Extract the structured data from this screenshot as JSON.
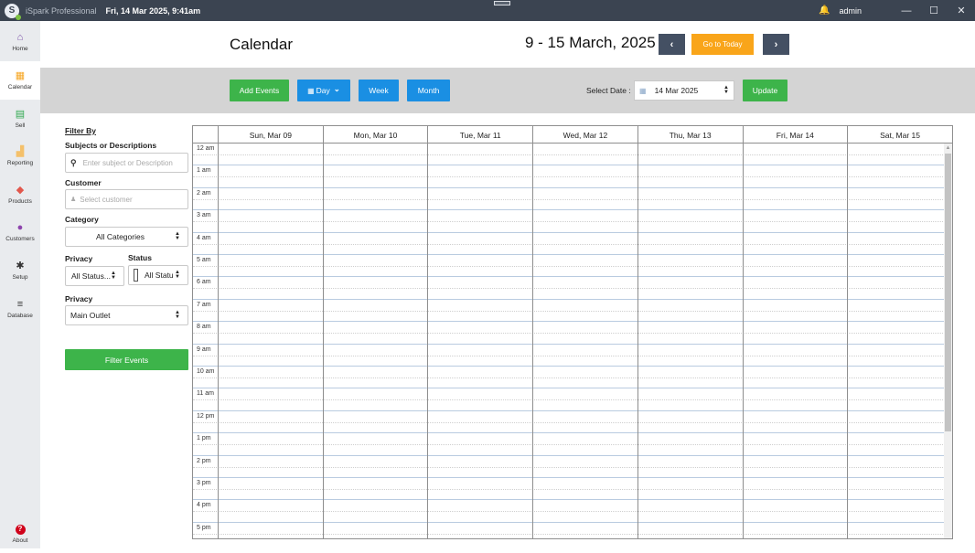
{
  "titlebar": {
    "logo": "S",
    "app_name": "iSpark Professional",
    "datetime": "Fri, 14 Mar 2025, 9:41am",
    "bell_icon": "🔔",
    "user": "admin",
    "minimize": "—",
    "maximize": "☐",
    "close": "✕"
  },
  "sidebar": {
    "items": [
      {
        "label": "Home",
        "icon": "⌂",
        "color": "#7b4fa8"
      },
      {
        "label": "Calendar",
        "icon": "▦",
        "color": "#f6a623"
      },
      {
        "label": "Sell",
        "icon": "▤",
        "color": "#2fa84f"
      },
      {
        "label": "Reporting",
        "icon": "▟",
        "color": "#f4c06a"
      },
      {
        "label": "Products",
        "icon": "◆",
        "color": "#e2574c"
      },
      {
        "label": "Customers",
        "icon": "●",
        "color": "#8e44ad"
      },
      {
        "label": "Setup",
        "icon": "✱",
        "color": "#333333"
      },
      {
        "label": "Database",
        "icon": "≡",
        "color": "#333333"
      }
    ],
    "about": {
      "label": "About",
      "icon": "?",
      "color": "#d0021b"
    }
  },
  "header": {
    "title": "Calendar",
    "range": "9 - 15 March, 2025",
    "prev_icon": "‹",
    "next_icon": "›",
    "today_label": "Go to Today"
  },
  "toolbar": {
    "add_events": "Add Events",
    "day": "Day",
    "day_icon": "▦",
    "day_chevron": "⌄",
    "week": "Week",
    "month": "Month",
    "select_date_label": "Select Date :",
    "date_value": "14 Mar 2025",
    "calendar_icon": "▦",
    "update": "Update"
  },
  "filter": {
    "heading": "Filter By",
    "subjects_label": "Subjects or Descriptions",
    "subjects_placeholder": "Enter subject or Description",
    "search_icon": "⚲",
    "customer_label": "Customer",
    "customer_placeholder": "Select customer",
    "user_icon": "♟",
    "category_label": "Category",
    "category_value": "All Categories",
    "privacy_label": "Privacy",
    "privacy_value": "All Status...",
    "status_label": "Status",
    "status_value": "All Statu",
    "outlet_label": "Privacy",
    "outlet_value": "Main Outlet",
    "filter_button": "Filter Events"
  },
  "calendar": {
    "days": [
      "Sun, Mar 09",
      "Mon, Mar 10",
      "Tue, Mar 11",
      "Wed, Mar 12",
      "Thu, Mar 13",
      "Fri, Mar 14",
      "Sat, Mar 15"
    ],
    "hours": [
      "12 am",
      "1 am",
      "2 am",
      "3 am",
      "4 am",
      "5 am",
      "6 am",
      "7 am",
      "8 am",
      "9 am",
      "10 am",
      "11 am",
      "12 pm",
      "1 pm",
      "2 pm",
      "3 pm",
      "4 pm",
      "5 pm"
    ],
    "scroll_up_icon": "▲"
  }
}
